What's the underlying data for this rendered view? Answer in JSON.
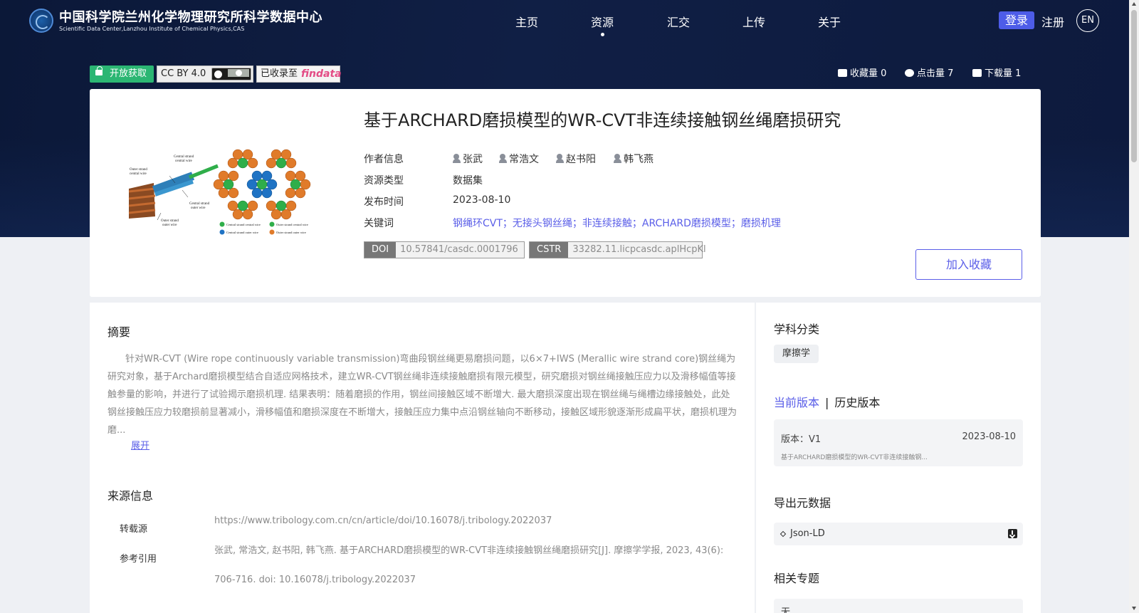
{
  "header": {
    "logo_cn": "中国科学院兰州化学物理研究所科学数据中心",
    "logo_en": "Scientific Data Center,Lanzhou Institute of Chemical Physics,CAS",
    "nav": [
      "主页",
      "资源",
      "汇交",
      "上传",
      "关于"
    ],
    "active_nav": "资源",
    "login": "登录",
    "register": "注册",
    "lang": "EN"
  },
  "badges": {
    "open_access": "开放获取",
    "license": "CC BY 4.0",
    "indexed_in": "已收录至",
    "indexed_logo": "findata"
  },
  "stats": {
    "favorites": "收藏量 0",
    "views": "点击量 7",
    "downloads": "下载量 1"
  },
  "dataset": {
    "title": "基于ARCHARD磨损模型的WR-CVT非连续接触钢丝绳磨损研究",
    "labels": {
      "authors": "作者信息",
      "type": "资源类型",
      "date": "发布时间",
      "keywords": "关键词"
    },
    "authors": [
      "张武",
      "常浩文",
      "赵书阳",
      "韩飞燕"
    ],
    "type": "数据集",
    "date": "2023-08-10",
    "keywords": "钢绳环CVT；无接头钢丝绳；非连续接触；ARCHARD磨损模型；磨损机理",
    "doi_label": "DOI",
    "doi": "10.57841/casdc.0001796",
    "cstr_label": "CSTR",
    "cstr": "33282.11.licpcasdc.aplHcpKl",
    "favorite_button": "加入收藏"
  },
  "thumbnail_labels": {
    "central_strand_central_wire": "Central strand central wire",
    "outer_strand_central_wire": "Outer strand central wire",
    "central_strand_outer_wire": "Central strand outer wire",
    "outer_strand_outer_wire": "Outer strand outer wire"
  },
  "abstract": {
    "title": "摘要",
    "text": "针对WR-CVT (Wire rope continuously variable transmission)弯曲段钢丝绳更易磨损问题，以6×7+IWS (Merallic wire strand core)钢丝绳为研究对象，基于Archard磨损模型结合自适应网格技术，建立WR-CVT钢丝绳非连续接触磨损有限元模型，研究磨损对钢丝绳接触压应力以及滑移幅值等接触参量的影响，并进行了试验揭示磨损机理. 结果表明：随着磨损的作用，钢丝间接触区域不断增大. 最大磨损深度出现在钢丝绳与绳槽边缘接触处，此处钢丝接触压应力较磨损前显著减小，滑移幅值和磨损深度在不断增大，接触压应力集中点沿钢丝轴向不断移动，接触区域形貌逐渐形成扁平状，磨损机理为磨...",
    "expand": "展开"
  },
  "source": {
    "title": "来源信息",
    "repost_label": "转载源",
    "repost_url": "https://www.tribology.com.cn/cn/article/doi/10.16078/j.tribology.2022037",
    "citation_label": "参考引用",
    "citation": "张武, 常浩文, 赵书阳, 韩飞燕. 基于ARCHARD磨损模型的WR-CVT非连续接触钢丝绳磨损研究[J]. 摩擦学学报, 2023, 43(6): 706-716. doi: 10.16078/j.tribology.2022037"
  },
  "sidebar": {
    "subject_title": "学科分类",
    "subject_tag": "摩擦学",
    "version_current": "当前版本",
    "version_sep": "|",
    "version_history": "历史版本",
    "version_label": "版本：V1",
    "version_date": "2023-08-10",
    "version_name": "基于ARCHARD磨损模型的WR-CVT非连续接触钢...",
    "export_title": "导出元数据",
    "export_format": "Json-LD",
    "topics_title": "相关专题",
    "topics_value": "无"
  },
  "colors": {
    "accent": "#5a5ee8",
    "open_green": "#2bb673",
    "header_bg": "#0d1a3d"
  }
}
